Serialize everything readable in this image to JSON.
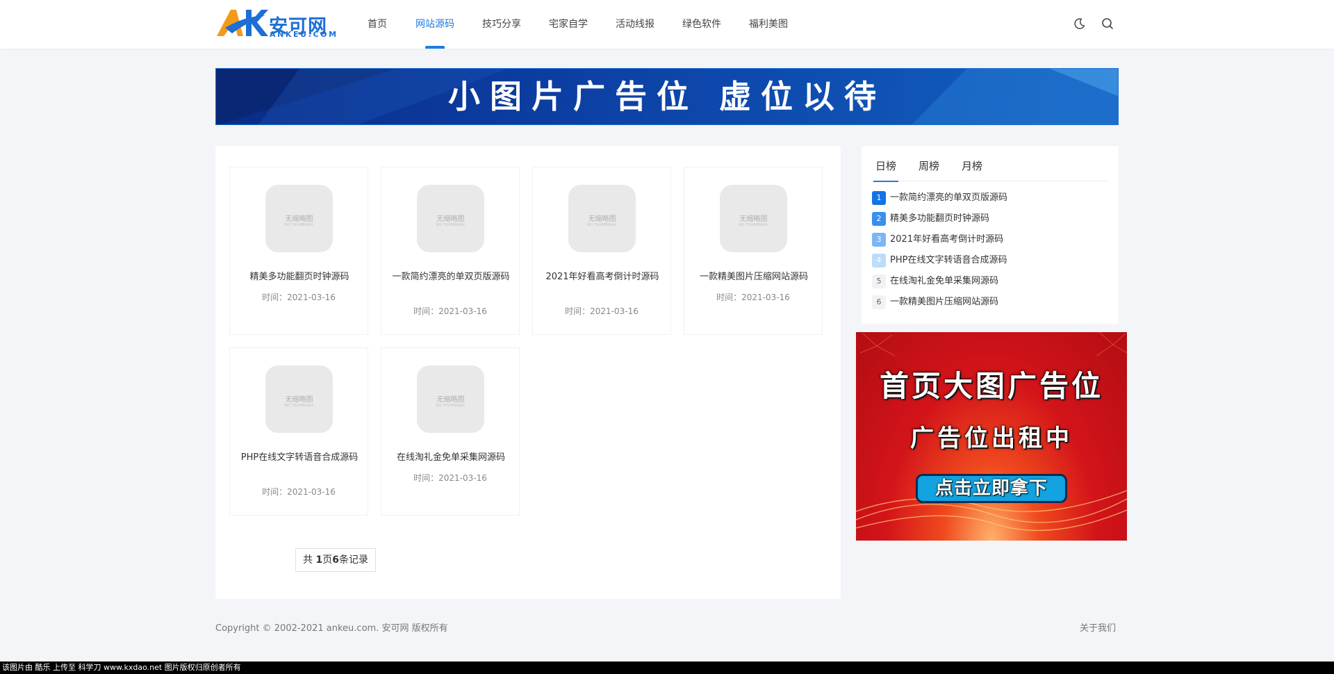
{
  "header": {
    "logo_cn": "安可网",
    "logo_en": "ANKEU.COM",
    "nav": [
      {
        "label": "首页"
      },
      {
        "label": "网站源码"
      },
      {
        "label": "技巧分享"
      },
      {
        "label": "宅家自学"
      },
      {
        "label": "活动线报"
      },
      {
        "label": "绿色软件"
      },
      {
        "label": "福利美图"
      }
    ],
    "active_nav": "网站源码",
    "icons": [
      "moon-icon",
      "search-icon"
    ]
  },
  "banner": {
    "text": "小图片广告位  虚位以待"
  },
  "posts": {
    "thumb_cn": "无缩略图",
    "thumb_en": "NO THUMBNAIL",
    "items": [
      {
        "title": "精美多功能翻页时钟源码",
        "time": "时间：2021-03-16"
      },
      {
        "title": "一款简约漂亮的单双页版源码",
        "time": "时间：2021-03-16"
      },
      {
        "title": "2021年好看高考倒计时源码",
        "time": "时间：2021-03-16"
      },
      {
        "title": "一款精美图片压缩网站源码",
        "time": "时间：2021-03-16"
      },
      {
        "title": "PHP在线文字转语音合成源码",
        "time": "时间：2021-03-16"
      },
      {
        "title": "在线淘礼金免单采集网源码",
        "time": "时间：2021-03-16"
      }
    ],
    "pager": {
      "prefix": "共 ",
      "pages": "1",
      "mid": "页",
      "count": "6",
      "suffix": "条记录"
    }
  },
  "ranking": {
    "tabs": [
      {
        "label": "日榜"
      },
      {
        "label": "周榜"
      },
      {
        "label": "月榜"
      }
    ],
    "active_tab": "日榜",
    "items": [
      {
        "num": "1",
        "title": "一款简约漂亮的单双页版源码"
      },
      {
        "num": "2",
        "title": "精美多功能翻页时钟源码"
      },
      {
        "num": "3",
        "title": "2021年好看高考倒计时源码"
      },
      {
        "num": "4",
        "title": "PHP在线文字转语音合成源码"
      },
      {
        "num": "5",
        "title": "在线淘礼金免单采集网源码"
      },
      {
        "num": "6",
        "title": "一款精美图片压缩网站源码"
      }
    ]
  },
  "side_ad": {
    "line1": "首页大图广告位",
    "line2": "广告位出租中",
    "cta": "点击立即拿下"
  },
  "footer": {
    "copyright": "Copyright © 2002-2021 ankeu.com. 安可网 版权所有",
    "about": "关于我们"
  },
  "watermark": "该图片由 酷乐 上传至 科学刀 www.kxdao.net 图片版权归原创者所有",
  "colors": {
    "accent": "#1e7be5",
    "page_bg": "#f3f5f8"
  }
}
